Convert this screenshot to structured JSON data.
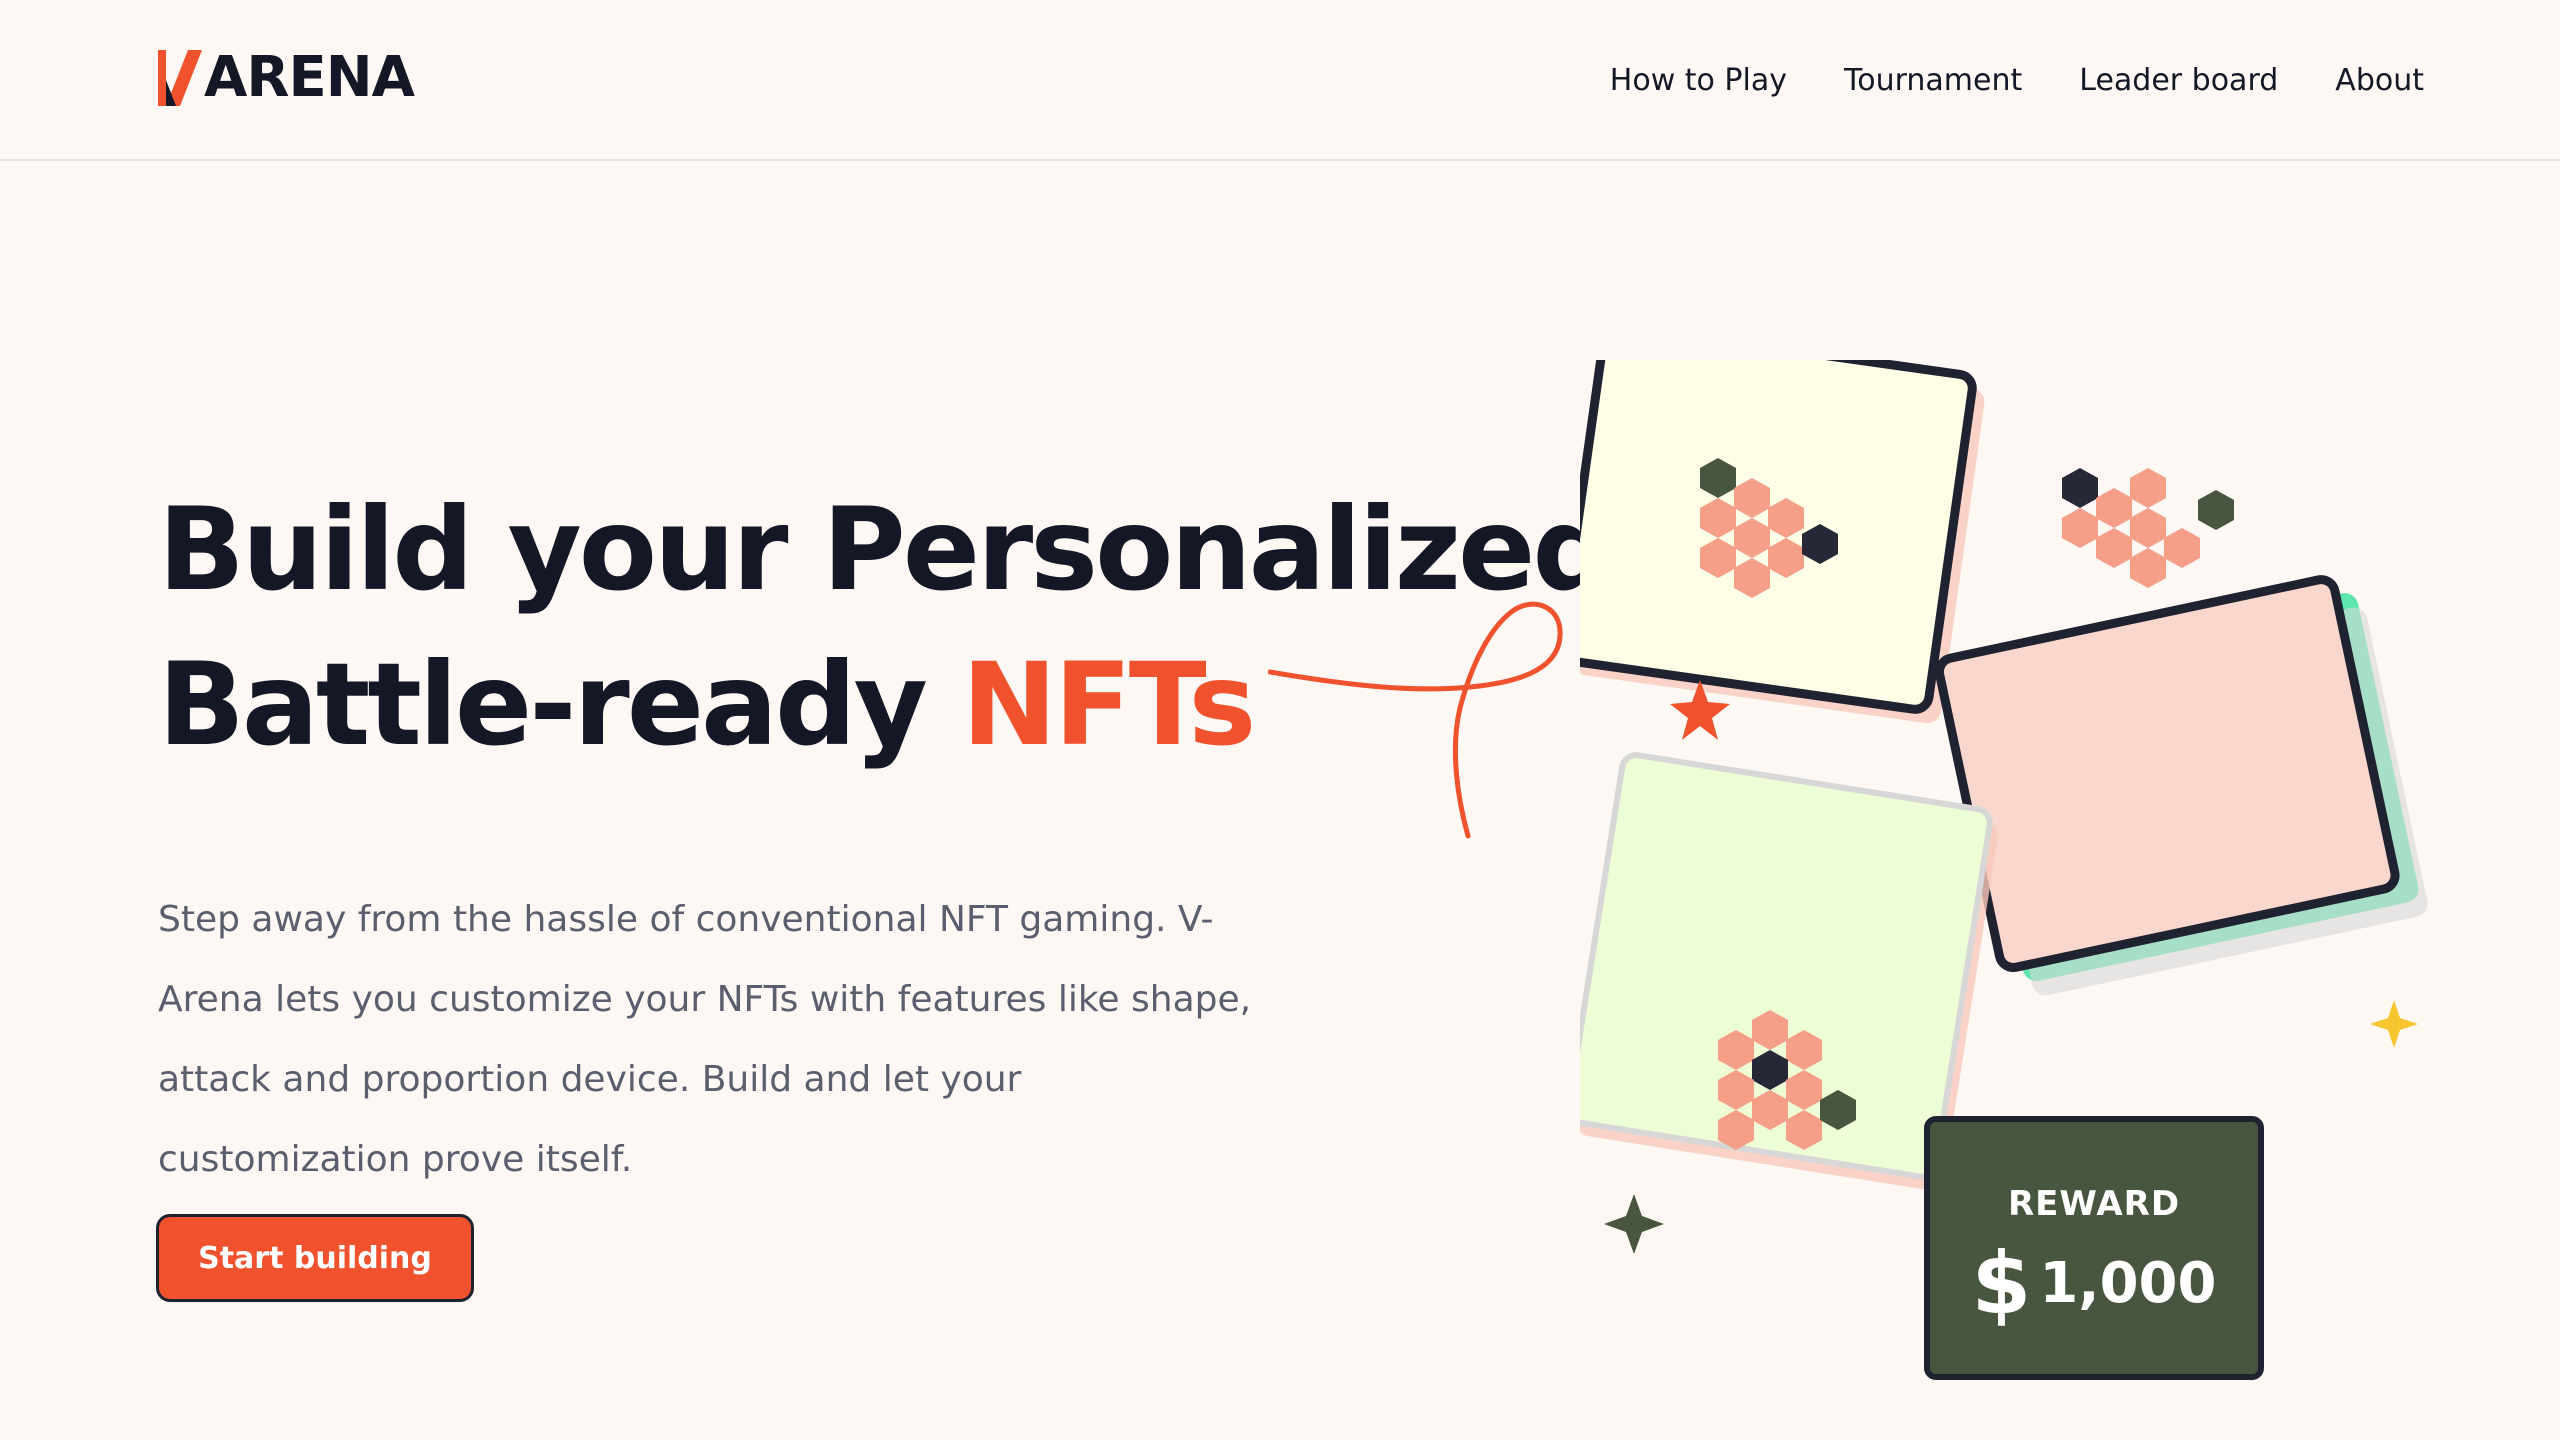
{
  "header": {
    "logo_text": "ARENA",
    "nav": [
      "How to Play",
      "Tournament",
      "Leader board",
      "About"
    ]
  },
  "hero": {
    "headline_line1": "Build your Personalized",
    "headline_line2_prefix": "Battle-ready ",
    "headline_line2_accent": "NFTs",
    "description": "Step away from the hassle of conventional NFT gaming. V-Arena lets you customize your NFTs with features like shape, attack and proportion device. Build and let your customization prove itself.",
    "cta_label": "Start building"
  },
  "reward": {
    "label": "REWARD",
    "currency": "$",
    "amount": "1,000"
  },
  "colors": {
    "accent": "#ef522d",
    "dark": "#141726",
    "muted_text": "#5b5e6e",
    "background": "#fdf8f4",
    "reward_bg": "#485640",
    "hex_salmon": "#f59e88"
  },
  "icons": [
    "logo-mark-icon",
    "scribble-decoration",
    "star-red-icon",
    "star-yellow-icon",
    "star-green-icon"
  ]
}
